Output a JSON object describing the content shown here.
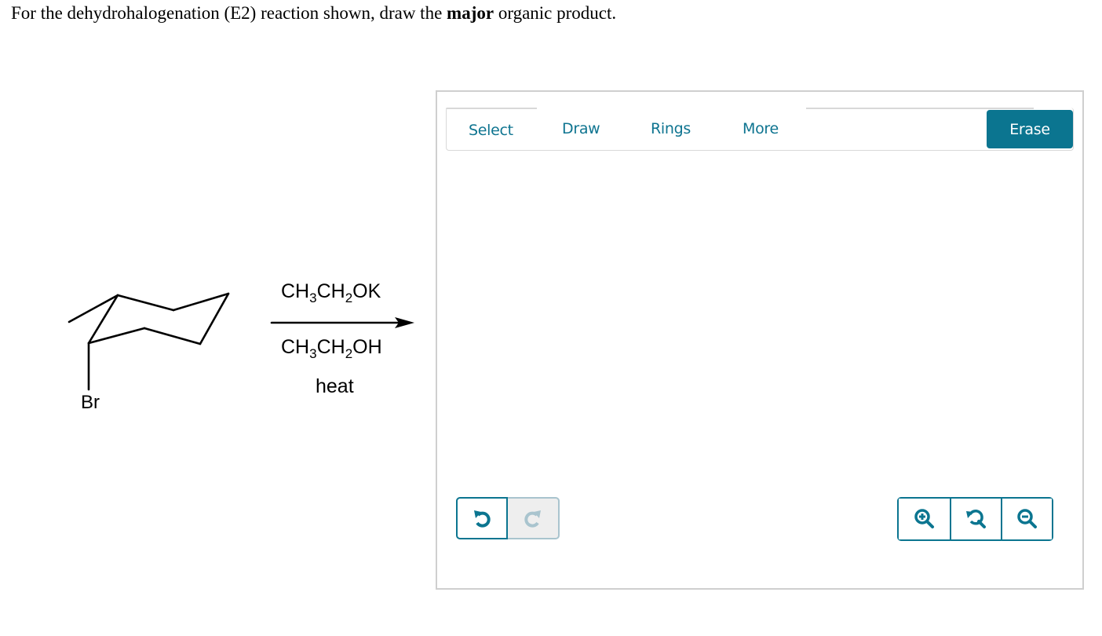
{
  "question": {
    "prefix": "For the dehydrohalogenation (E2) reaction shown, draw the ",
    "emphasis": "major",
    "suffix": " organic product."
  },
  "reaction": {
    "substrate_label": "Br",
    "reagent_above": {
      "parts": [
        "CH",
        "3",
        "CH",
        "2",
        "OK"
      ]
    },
    "reagent_below": {
      "parts": [
        "CH",
        "3",
        "CH",
        "2",
        "OH"
      ]
    },
    "condition": "heat"
  },
  "editor": {
    "tabs": [
      {
        "label": "Select"
      },
      {
        "label": "Draw"
      },
      {
        "label": "Rings"
      },
      {
        "label": "More"
      }
    ],
    "erase_label": "Erase",
    "colors": {
      "accent": "#0b7590",
      "disabled": "#a9c4ce",
      "border": "#cfcfcf"
    },
    "history_buttons": [
      {
        "icon": "undo-icon",
        "enabled": true
      },
      {
        "icon": "redo-icon",
        "enabled": false
      }
    ],
    "zoom_buttons": [
      {
        "icon": "zoom-in-icon"
      },
      {
        "icon": "zoom-reset-icon"
      },
      {
        "icon": "zoom-out-icon"
      }
    ]
  }
}
